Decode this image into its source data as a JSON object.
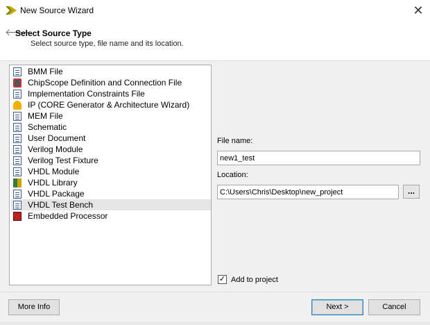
{
  "window": {
    "title": "New Source Wizard",
    "close_glyph": "✕"
  },
  "header": {
    "back_glyph": "🡐",
    "title": "Select Source Type",
    "subtitle": "Select source type, file name and its location."
  },
  "source_types": [
    {
      "label": "BMM File",
      "icon": "bmm-file-icon"
    },
    {
      "label": "ChipScope Definition and Connection File",
      "icon": "chipscope-icon"
    },
    {
      "label": "Implementation Constraints File",
      "icon": "constraints-file-icon"
    },
    {
      "label": "IP (CORE Generator & Architecture Wizard)",
      "icon": "ip-core-icon"
    },
    {
      "label": "MEM File",
      "icon": "mem-file-icon"
    },
    {
      "label": "Schematic",
      "icon": "schematic-icon"
    },
    {
      "label": "User Document",
      "icon": "user-document-icon"
    },
    {
      "label": "Verilog Module",
      "icon": "verilog-module-icon"
    },
    {
      "label": "Verilog Test Fixture",
      "icon": "verilog-test-fixture-icon"
    },
    {
      "label": "VHDL Module",
      "icon": "vhdl-module-icon"
    },
    {
      "label": "VHDL Library",
      "icon": "vhdl-library-icon"
    },
    {
      "label": "VHDL Package",
      "icon": "vhdl-package-icon"
    },
    {
      "label": "VHDL Test Bench",
      "icon": "vhdl-test-bench-icon",
      "selected": true
    },
    {
      "label": "Embedded Processor",
      "icon": "embedded-processor-icon"
    }
  ],
  "form": {
    "file_name_label": "File name:",
    "file_name_value": "new1_test",
    "location_label": "Location:",
    "location_value": "C:\\Users\\Chris\\Desktop\\new_project",
    "browse_label": "...",
    "add_to_project_label": "Add to project",
    "add_to_project_checked": true,
    "check_glyph": "✓"
  },
  "footer": {
    "more_info_label": "More Info",
    "next_label": "Next >",
    "cancel_label": "Cancel"
  },
  "colors": {
    "accent_border": "#3c7fb1",
    "selected_row": "#e5e5e5",
    "dialog_bg": "#f0f0f0"
  }
}
